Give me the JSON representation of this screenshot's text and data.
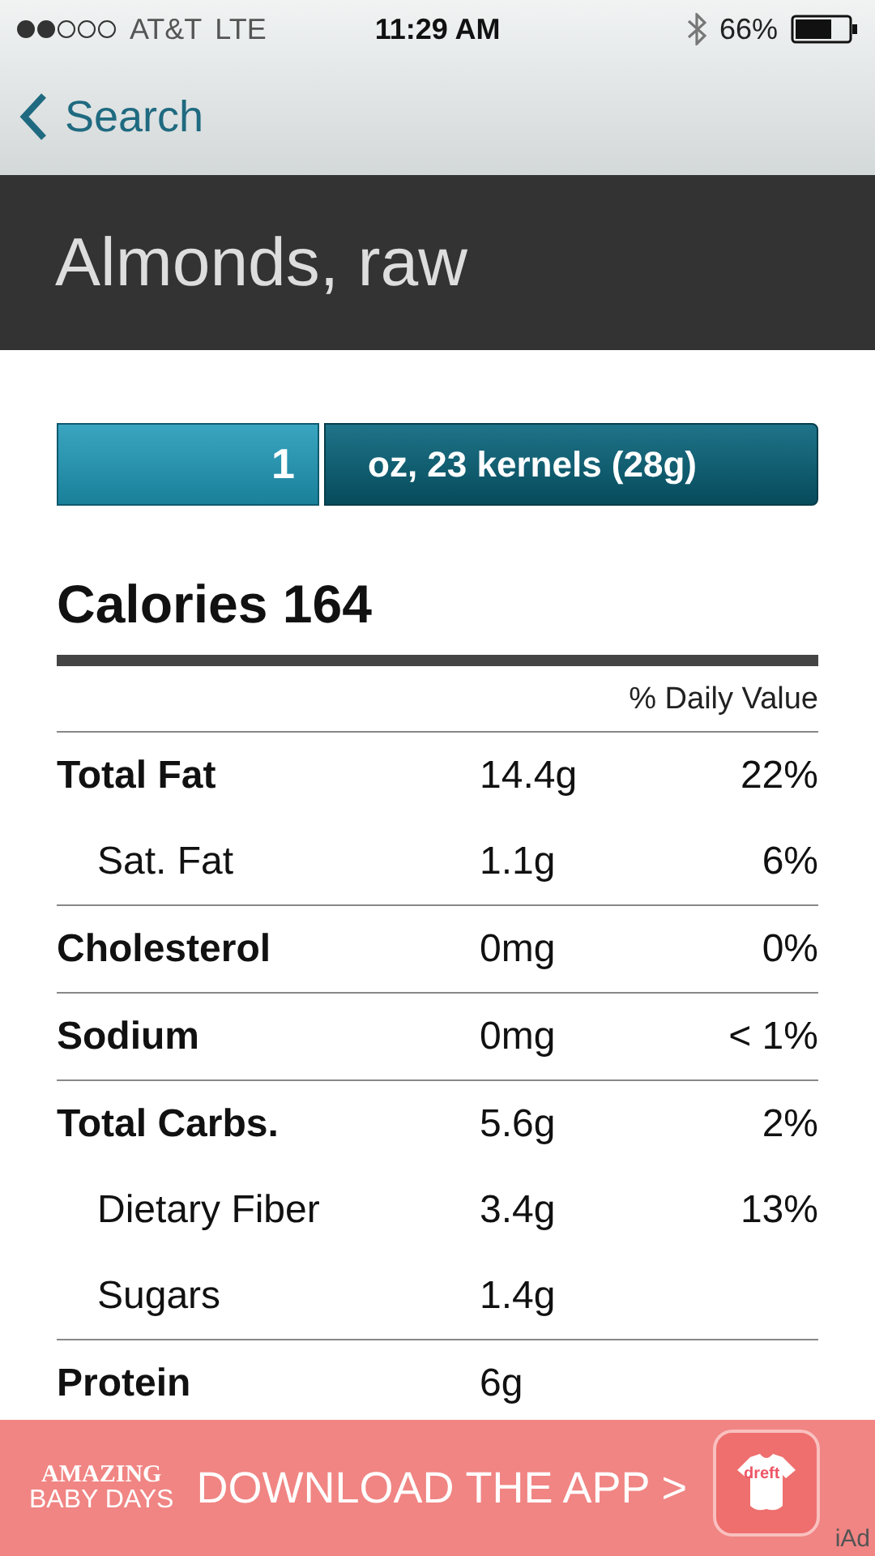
{
  "status_bar": {
    "carrier": "AT&T",
    "network": "LTE",
    "time": "11:29 AM",
    "battery": "66%"
  },
  "nav": {
    "back": "Search"
  },
  "header": {
    "title": "Almonds, raw"
  },
  "serving": {
    "quantity": "1",
    "unit": "oz, 23 kernels (28g)"
  },
  "calories": "Calories 164",
  "dv_heading": "% Daily Value",
  "rows": [
    {
      "kind": "main",
      "name": "Total Fat",
      "amount": "14.4g",
      "dv": "22%"
    },
    {
      "kind": "sub",
      "name": "Sat. Fat",
      "amount": "1.1g",
      "dv": "6%"
    },
    {
      "kind": "main",
      "name": "Cholesterol",
      "amount": "0mg",
      "dv": "0%"
    },
    {
      "kind": "main",
      "name": "Sodium",
      "amount": "0mg",
      "dv": "< 1%"
    },
    {
      "kind": "main",
      "name": "Total Carbs.",
      "amount": "5.6g",
      "dv": "2%"
    },
    {
      "kind": "sub",
      "name": "Dietary Fiber",
      "amount": "3.4g",
      "dv": "13%"
    },
    {
      "kind": "sub",
      "name": "Sugars",
      "amount": "1.4g"
    },
    {
      "kind": "main",
      "name": "Protein",
      "amount": "6g"
    }
  ],
  "ad": {
    "brand_top": "AMAZING",
    "brand_bottom": "BABY DAYS",
    "cta": "DOWNLOAD THE APP >",
    "icon_text": "dreft",
    "network": "iAd"
  }
}
